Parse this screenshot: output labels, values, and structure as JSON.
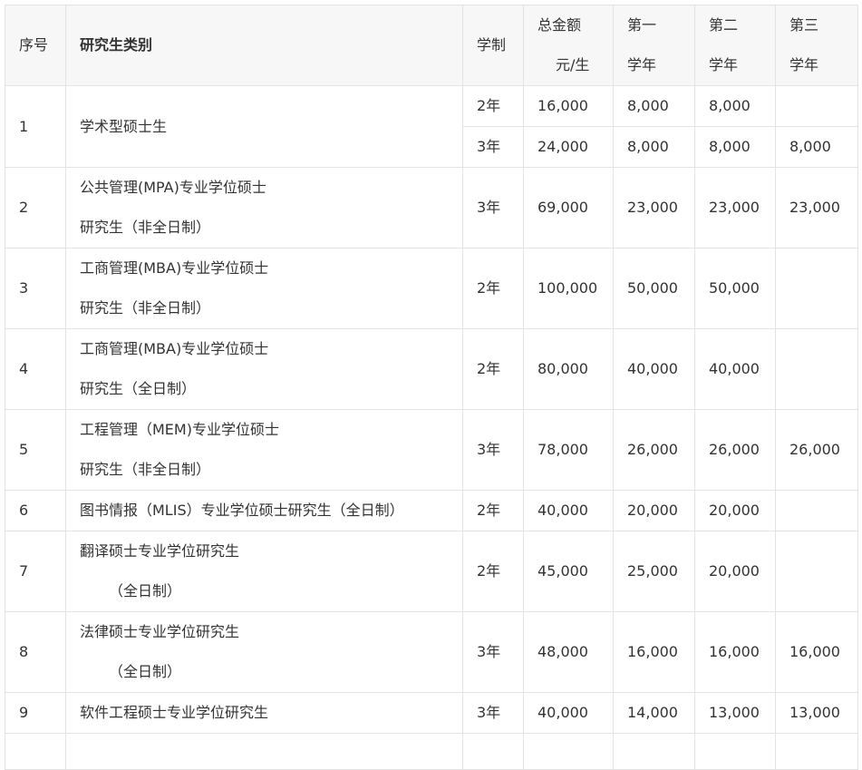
{
  "table": {
    "headers": {
      "no": "序号",
      "category": "研究生类别",
      "duration": "学制",
      "total_line1": "总金额",
      "total_line2": "元/生",
      "y1_line1": "第一",
      "y1_line2": "学年",
      "y2_line1": "第二",
      "y2_line2": "学年",
      "y3_line1": "第三",
      "y3_line2": "学年"
    },
    "rows": [
      {
        "no": "1",
        "category_line1": "学术型硕士生",
        "duration": "2年",
        "total": "16,000",
        "y1": "8,000",
        "y2": "8,000",
        "y3": ""
      },
      {
        "duration": "3年",
        "total": "24,000",
        "y1": "8,000",
        "y2": "8,000",
        "y3": "8,000"
      },
      {
        "no": "2",
        "category_line1": "公共管理(MPA)专业学位硕士",
        "category_line2": "研究生（非全日制）",
        "duration": "3年",
        "total": "69,000",
        "y1": "23,000",
        "y2": "23,000",
        "y3": "23,000"
      },
      {
        "no": "3",
        "category_line1": "工商管理(MBA)专业学位硕士",
        "category_line2": "研究生（非全日制）",
        "duration": "2年",
        "total": "100,000",
        "y1": "50,000",
        "y2": "50,000",
        "y3": ""
      },
      {
        "no": "4",
        "category_line1": "工商管理(MBA)专业学位硕士",
        "category_line2": "研究生（全日制）",
        "duration": "2年",
        "total": "80,000",
        "y1": "40,000",
        "y2": "40,000",
        "y3": ""
      },
      {
        "no": "5",
        "category_line1": "工程管理（MEM)专业学位硕士",
        "category_line2": "研究生（非全日制）",
        "duration": "3年",
        "total": "78,000",
        "y1": "26,000",
        "y2": "26,000",
        "y3": "26,000"
      },
      {
        "no": "6",
        "category_line1": "图书情报（MLIS）专业学位硕士研究生（全日制）",
        "duration": "2年",
        "total": "40,000",
        "y1": "20,000",
        "y2": "20,000",
        "y3": ""
      },
      {
        "no": "7",
        "category_line1": "翻译硕士专业学位研究生",
        "category_line2": "（全日制）",
        "duration": "2年",
        "total": "45,000",
        "y1": "25,000",
        "y2": "20,000",
        "y3": ""
      },
      {
        "no": "8",
        "category_line1": "法律硕士专业学位研究生",
        "category_line2": "（全日制）",
        "duration": "3年",
        "total": "48,000",
        "y1": "16,000",
        "y2": "16,000",
        "y3": "16,000"
      },
      {
        "no": "9",
        "category_line1": "软件工程硕士专业学位研究生",
        "duration": "3年",
        "total": "40,000",
        "y1": "14,000",
        "y2": "13,000",
        "y3": "13,000"
      }
    ]
  }
}
